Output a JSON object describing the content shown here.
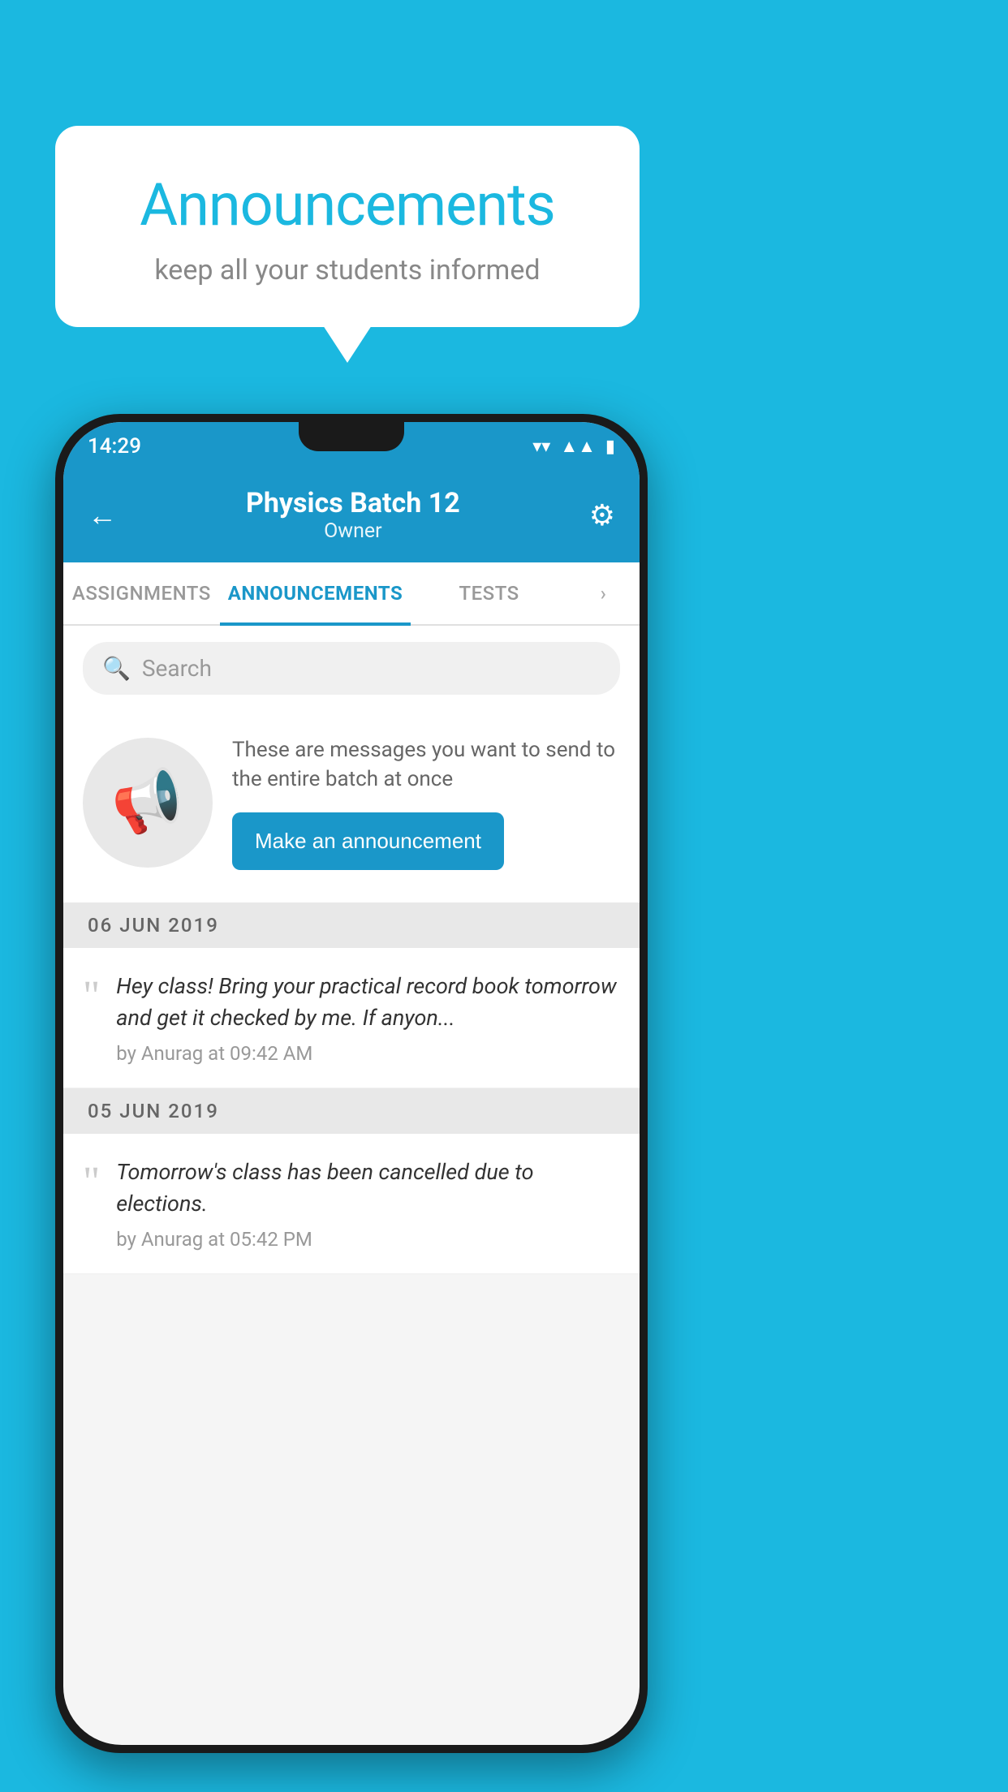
{
  "background_color": "#1BB8E0",
  "speech_bubble": {
    "title": "Announcements",
    "subtitle": "keep all your students informed"
  },
  "status_bar": {
    "time": "14:29",
    "icons": [
      "wifi",
      "signal",
      "battery"
    ]
  },
  "app_header": {
    "back_label": "←",
    "title": "Physics Batch 12",
    "subtitle": "Owner",
    "gear_label": "⚙"
  },
  "tabs": [
    {
      "label": "ASSIGNMENTS",
      "active": false
    },
    {
      "label": "ANNOUNCEMENTS",
      "active": true
    },
    {
      "label": "TESTS",
      "active": false
    },
    {
      "label": "•••",
      "active": false
    }
  ],
  "search": {
    "placeholder": "Search"
  },
  "promo": {
    "description": "These are messages you want to send to the entire batch at once",
    "button_label": "Make an announcement"
  },
  "announcements": [
    {
      "date": "06  JUN  2019",
      "text": "Hey class! Bring your practical record book tomorrow and get it checked by me. If anyon...",
      "meta": "by Anurag at 09:42 AM"
    },
    {
      "date": "05  JUN  2019",
      "text": "Tomorrow's class has been cancelled due to elections.",
      "meta": "by Anurag at 05:42 PM"
    }
  ]
}
